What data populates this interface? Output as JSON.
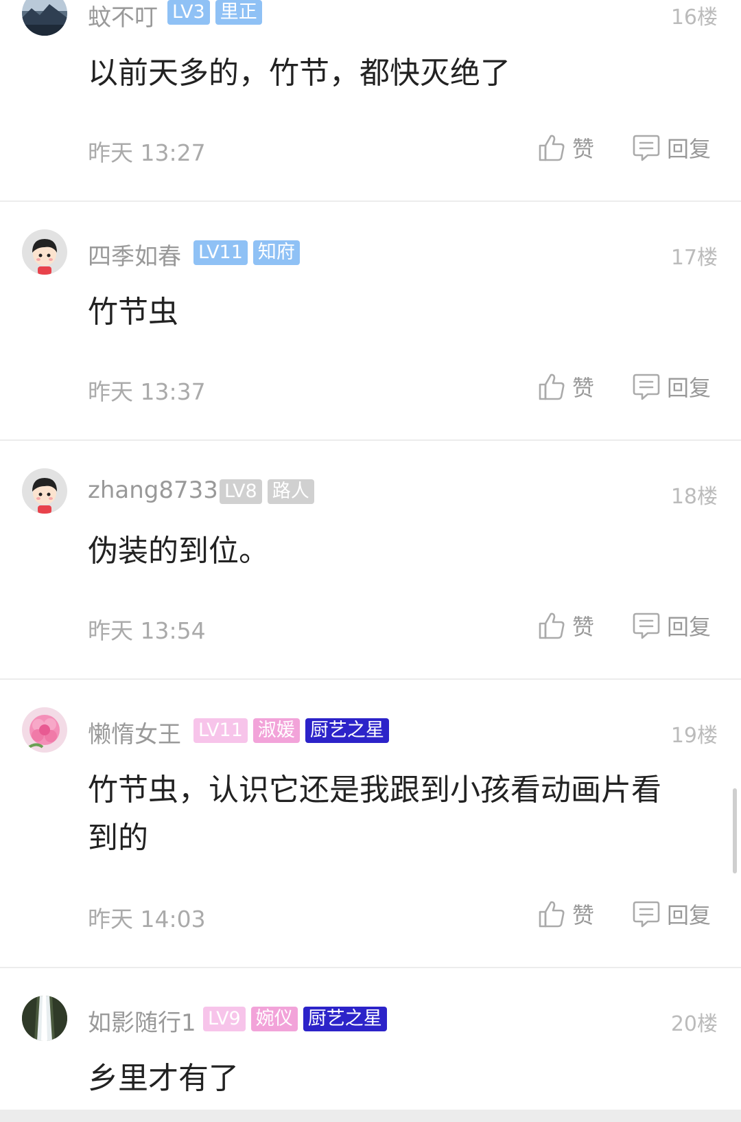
{
  "comments": [
    {
      "username": "蚊不叮",
      "level": "LV3",
      "badges": [
        {
          "text": "里正",
          "color": "#8fc1f5"
        }
      ],
      "level_color": "#8fc1f5",
      "floor": "16楼",
      "content": "以前天多的，竹节，都快灭绝了",
      "time": "昨天 13:27",
      "avatar_icon": "landscape-avatar-icon"
    },
    {
      "username": "四季如春",
      "level": "LV11",
      "badges": [
        {
          "text": "知府",
          "color": "#8fc1f5"
        }
      ],
      "level_color": "#8fc1f5",
      "floor": "17楼",
      "content": "竹节虫",
      "time": "昨天 13:37",
      "avatar_icon": "cartoon-avatar-icon"
    },
    {
      "username": "zhang8733",
      "level": "LV8",
      "badges": [
        {
          "text": "路人",
          "color": "#d0d0d0"
        }
      ],
      "level_color": "#d0d0d0",
      "floor": "18楼",
      "content": "伪装的到位。",
      "time": "昨天 13:54",
      "avatar_icon": "cartoon-avatar-icon"
    },
    {
      "username": "懒惰女王",
      "level": "LV11",
      "badges": [
        {
          "text": "淑媛",
          "color": "#f2a3d9"
        },
        {
          "text": "厨艺之星",
          "color": "#2c23c9"
        }
      ],
      "level_color": "#f7c4ea",
      "floor": "19楼",
      "content": "竹节虫，认识它还是我跟到小孩看动画片看到的",
      "time": "昨天 14:03",
      "avatar_icon": "flower-avatar-icon"
    },
    {
      "username": "如影随行1",
      "level": "LV9",
      "badges": [
        {
          "text": "婉仪",
          "color": "#f2a3d9"
        },
        {
          "text": "厨艺之星",
          "color": "#2c23c9"
        }
      ],
      "level_color": "#f7c4ea",
      "floor": "20楼",
      "content": "乡里才有了",
      "time": "",
      "avatar_icon": "waterfall-avatar-icon"
    }
  ],
  "actions": {
    "like_label": "赞",
    "reply_label": "回复",
    "like_icon": "thumbs-up-icon",
    "reply_icon": "comment-icon"
  }
}
